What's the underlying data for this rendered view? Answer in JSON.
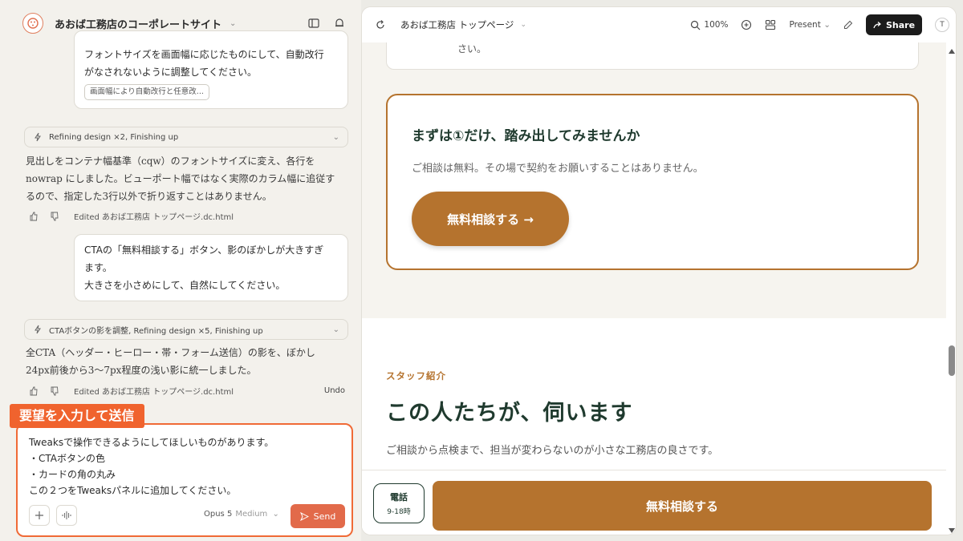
{
  "project": {
    "title": "あおば工務店のコーポレートサイト"
  },
  "chat": {
    "msg1": {
      "line1": "フォントサイズを画面幅に応じたものにして、自動改行",
      "line2": "がなされないように調整してください。",
      "chip": "画面幅により自動改行と任意改..."
    },
    "status1": "Refining design ×2, Finishing up",
    "reply1": {
      "line1": "見出しをコンテナ幅基準（cqw）のフォントサイズに変え、各行を",
      "line2": "nowrap にしました。ビューポート幅ではなく実際のカラム幅に追従す",
      "line3": "るので、指定した3行以外で折り返すことはありません。"
    },
    "edited1": "Edited あおば工務店 トップページ.dc.html",
    "msg2": {
      "line1": "CTAの「無料相談する」ボタン、影のぼかしが大きすぎ",
      "line2": "ます。",
      "line3": "大きさを小さめにして、自然にしてください。"
    },
    "status2": "CTAボタンの影を調整, Refining design ×5, Finishing up",
    "reply2": {
      "line1": "全CTA（ヘッダー・ヒーロー・帯・フォーム送信）の影を、ぼかし",
      "line2": "24px前後から3〜7px程度の浅い影に統一しました。"
    },
    "edited2": "Edited あおば工務店 トップページ.dc.html",
    "undo": "Undo"
  },
  "callout": "要望を入力して送信",
  "composer": {
    "line1": "Tweaksで操作できるようにしてほしいものがあります。",
    "line2": "・CTAボタンの色",
    "line3": "・カードの角の丸み",
    "line4": "この２つをTweaksパネルに追加してください。",
    "model": "Opus 5",
    "level": "Medium",
    "send": "Send"
  },
  "preview": {
    "page_title": "あおば工務店 トップページ",
    "zoom": "100%",
    "present": "Present",
    "share": "Share",
    "avatar": "T",
    "top_card_tail": "さい。",
    "cta_heading": "まずは①だけ、踏み出してみませんか",
    "cta_text": "ご相談は無料。その場で契約をお願いすることはありません。",
    "cta_button": "無料相談する →",
    "staff_eyebrow": "スタッフ紹介",
    "staff_heading": "この人たちが、伺います",
    "staff_text": "ご相談から点検まで、担当が変わらないのが小さな工務店の良さです。",
    "tel_label": "電話",
    "tel_hours": "9-18時",
    "bottom_cta": "無料相談する"
  },
  "colors": {
    "accent": "#b5732e",
    "send": "#e26a4a",
    "callout": "#f0632e",
    "dark_green": "#1f3a2e"
  }
}
